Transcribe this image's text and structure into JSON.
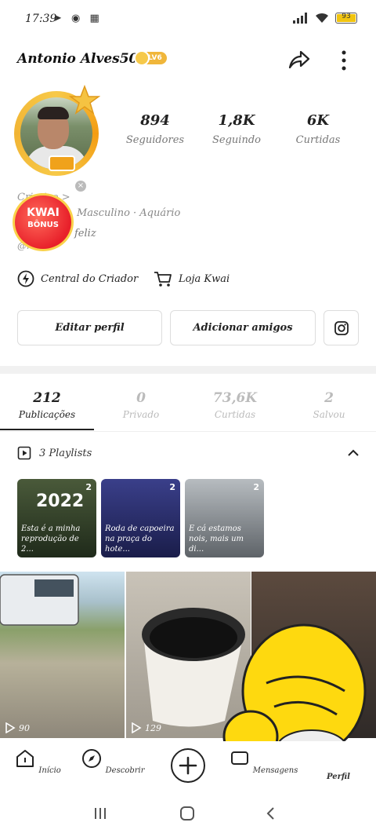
{
  "status_bar": {
    "time": "17:39",
    "left_icons": "➤ ◉ ▦",
    "battery": "93"
  },
  "header": {
    "username": "Antonio Alves5032",
    "level": "LV6"
  },
  "stats": [
    {
      "value": "894",
      "label": "Seguidores"
    },
    {
      "value": "1,8K",
      "label": "Seguindo"
    },
    {
      "value": "6K",
      "label": "Curtidas"
    }
  ],
  "profile": {
    "tag": "Criativo >",
    "info": "Masculino · Aquário",
    "bio": "feliz",
    "handle": "@r...8",
    "kwai_bonus_line1": "KWAI",
    "kwai_bonus_line2": "BÔNUS",
    "kwai_close": "×"
  },
  "links": {
    "creator_center": "Central do Criador",
    "kwai_store": "Loja Kwai"
  },
  "buttons": {
    "edit_profile": "Editar perfil",
    "add_friends": "Adicionar amigos"
  },
  "tabs": [
    {
      "value": "212",
      "label": "Publicações",
      "active": true
    },
    {
      "value": "0",
      "label": "Privado",
      "active": false
    },
    {
      "value": "73,6K",
      "label": "Curtidas",
      "active": false
    },
    {
      "value": "2",
      "label": "Salvou",
      "active": false
    }
  ],
  "playlists": {
    "header": "3 Playlists",
    "items": [
      {
        "count": "2",
        "title": "Esta é a minha reprodução de 2...",
        "year": "2022",
        "color": "#2f3a2a"
      },
      {
        "count": "2",
        "title": "Roda de capoeira na praça do hote...",
        "color": "#2a2e6a"
      },
      {
        "count": "2",
        "title": "E cá estamos nois, mais um di...",
        "color": "#8a8f93"
      }
    ]
  },
  "videos": [
    {
      "views": "90"
    },
    {
      "views": "129"
    },
    {
      "views": ""
    }
  ],
  "nav": {
    "home": "Início",
    "discover": "Descobrir",
    "messages": "Mensagens",
    "profile": "Perfil"
  },
  "colors": {
    "accent_gold": "#f0b63a",
    "text_primary": "#222222",
    "text_muted": "#888888"
  }
}
